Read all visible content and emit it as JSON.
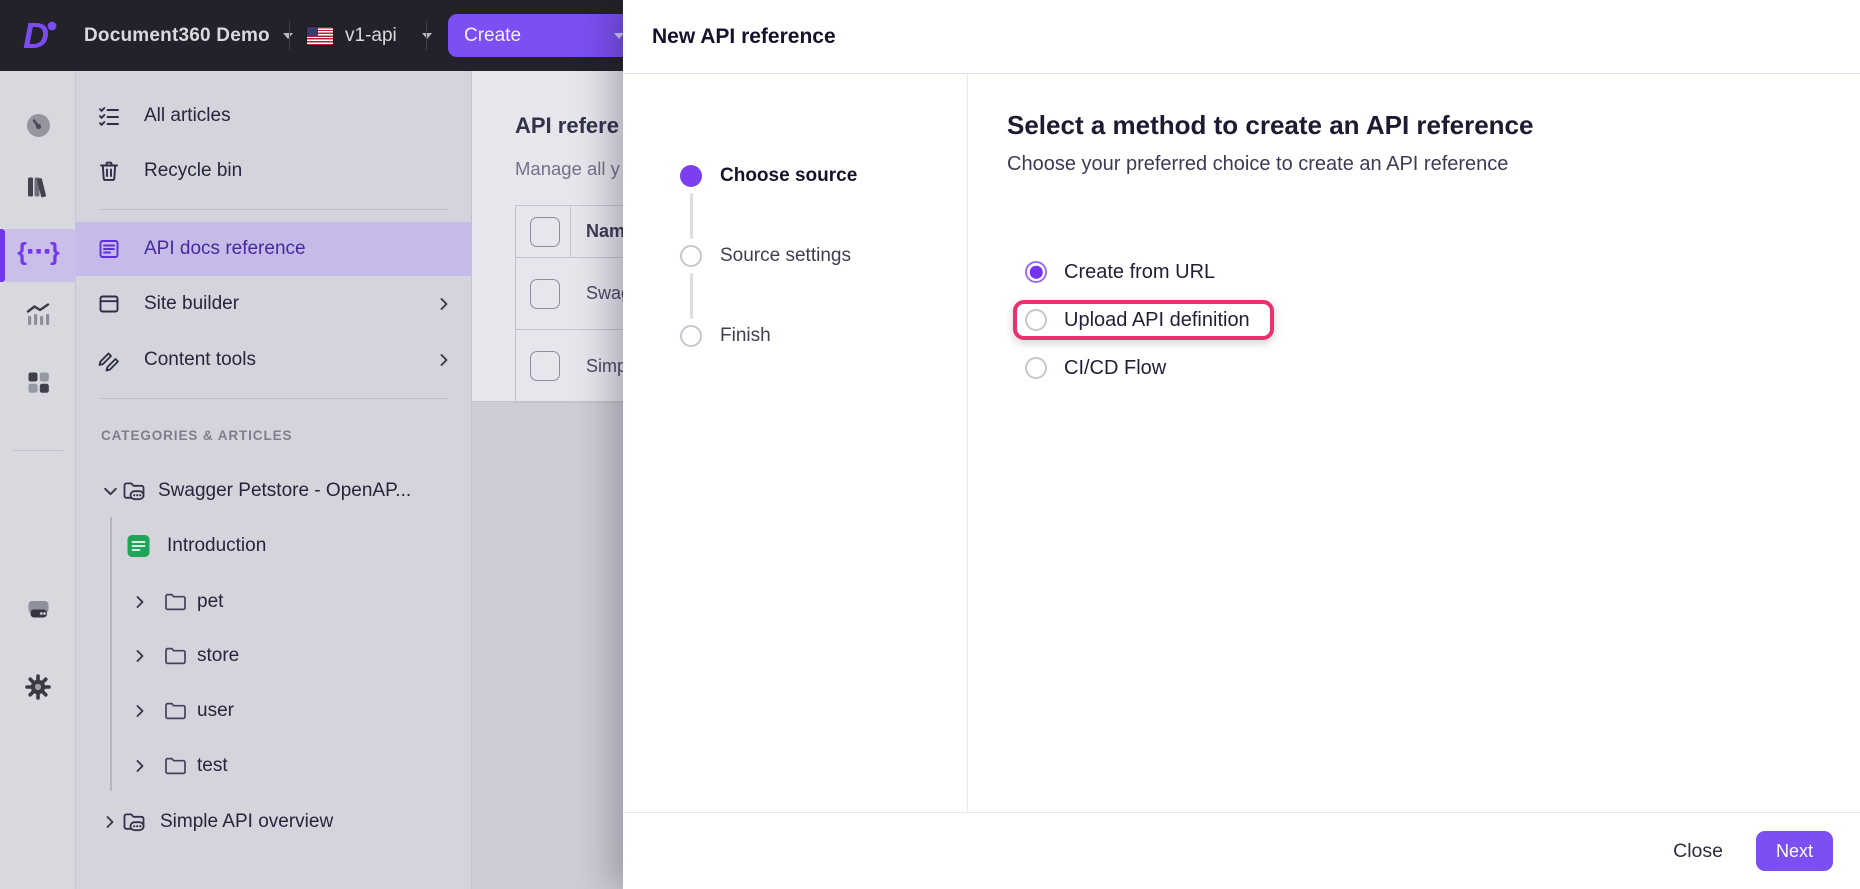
{
  "topbar": {
    "brand": "Document360 Demo",
    "environment": "v1-api",
    "create_label": "Create"
  },
  "rail": {
    "icons": [
      "dashboard-icon",
      "documentation-icon",
      "api-docs-icon",
      "analytics-icon",
      "widgets-icon",
      "drive-icon",
      "settings-gear-icon"
    ],
    "active_icon": "api-docs-icon"
  },
  "sidebar": {
    "nav": [
      {
        "label": "All articles",
        "icon": "checklist-icon",
        "active": false
      },
      {
        "label": "Recycle bin",
        "icon": "trash-icon",
        "active": false
      },
      {
        "label": "API docs reference",
        "icon": "api-reference-icon",
        "active": true
      },
      {
        "label": "Site builder",
        "icon": "window-icon",
        "active": false,
        "expandable": true
      },
      {
        "label": "Content tools",
        "icon": "tools-icon",
        "active": false,
        "expandable": true
      }
    ],
    "section_label": "CATEGORIES & ARTICLES",
    "tree": [
      {
        "label": "Swagger Petstore - OpenAP...",
        "type": "api-category",
        "expanded": true
      },
      {
        "label": "Introduction",
        "type": "article"
      },
      {
        "label": "pet",
        "type": "folder"
      },
      {
        "label": "store",
        "type": "folder"
      },
      {
        "label": "user",
        "type": "folder"
      },
      {
        "label": "test",
        "type": "folder"
      },
      {
        "label": "Simple API overview",
        "type": "api-category",
        "expanded": false
      }
    ]
  },
  "content": {
    "title": "API refere",
    "subtitle": "Manage all y",
    "table": {
      "name_header": "Nam",
      "rows": [
        {
          "name": "Swag"
        },
        {
          "name": "Simp"
        }
      ]
    }
  },
  "modal": {
    "title": "New API reference",
    "steps": [
      {
        "label": "Choose source",
        "state": "active"
      },
      {
        "label": "Source settings",
        "state": "upcoming"
      },
      {
        "label": "Finish",
        "state": "upcoming"
      }
    ],
    "heading": "Select a method to create an API reference",
    "subheading": "Choose your preferred choice to create an API reference",
    "options": [
      {
        "label": "Create from URL",
        "selected": true,
        "highlighted": false
      },
      {
        "label": "Upload API definition",
        "selected": false,
        "highlighted": true
      },
      {
        "label": "CI/CD Flow",
        "selected": false,
        "highlighted": false
      }
    ],
    "footer": {
      "close_label": "Close",
      "next_label": "Next"
    }
  },
  "colors": {
    "accent_purple": "#7b4ff2",
    "highlight_pink": "#ec2f6e",
    "topbar_bg": "#232129",
    "active_nav_bg": "#c6bbe8"
  }
}
